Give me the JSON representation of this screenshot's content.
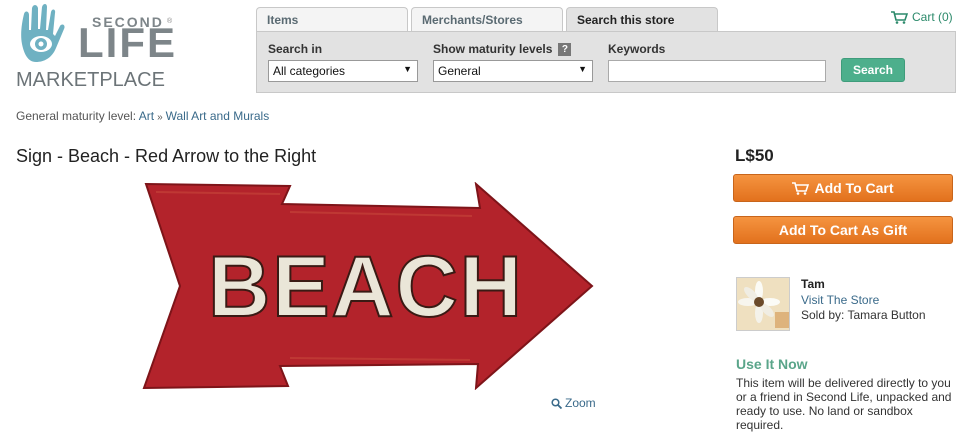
{
  "logo": {
    "second": "SECOND",
    "life": "LIFE",
    "marketplace": "MARKETPLACE",
    "reg": "®"
  },
  "tabs": [
    {
      "label": "Items"
    },
    {
      "label": "Merchants/Stores"
    },
    {
      "label": "Search this store"
    }
  ],
  "cart": {
    "label": "Cart (0)",
    "icon": "cart-icon"
  },
  "search": {
    "search_in_label": "Search in",
    "search_in_value": "All categories",
    "maturity_label": "Show maturity levels",
    "maturity_help": "?",
    "maturity_value": "General",
    "keywords_label": "Keywords",
    "keywords_value": "",
    "button_label": "Search"
  },
  "breadcrumb": {
    "prefix": "General maturity level:",
    "items": [
      "Art",
      "Wall Art and Murals"
    ],
    "separator": "»"
  },
  "product": {
    "title": "Sign - Beach - Red Arrow to the Right",
    "image_text": "BEACH",
    "zoom_label": "Zoom",
    "price": "L$50",
    "add_to_cart": "Add To Cart",
    "add_to_cart_gift": "Add To Cart As Gift"
  },
  "seller": {
    "name": "Tam",
    "visit_label": "Visit The Store",
    "sold_by": "Sold by: Tamara Button"
  },
  "use_it_now": {
    "heading": "Use It Now",
    "text": "This item will be delivered directly to you or a friend in Second Life, unpacked and ready to use. No land or sandbox required."
  },
  "colors": {
    "accent_green": "#4daf8c",
    "link_blue": "#3a6a8a",
    "orange": "#e2711d",
    "sign_red": "#b3232b"
  }
}
